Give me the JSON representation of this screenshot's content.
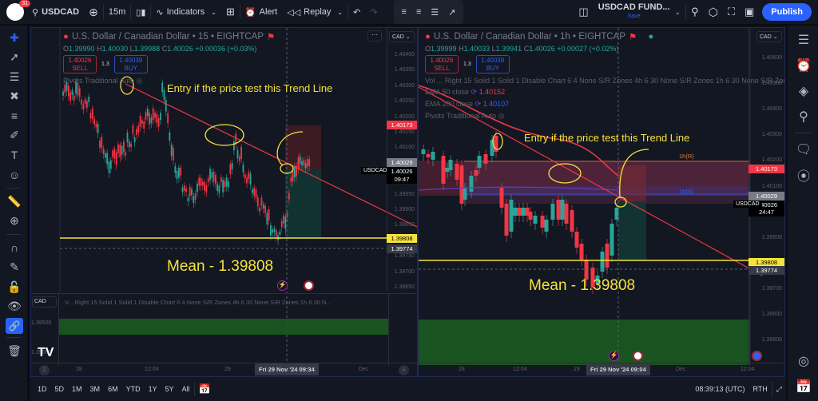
{
  "topbar": {
    "notifications": "31",
    "symbol": "USDCAD",
    "interval": "15m",
    "indicators": "Indicators",
    "alert": "Alert",
    "replay": "Replay",
    "layout_name": "USDCAD FUND...",
    "layout_status": "Save",
    "publish": "Publish"
  },
  "left_chart": {
    "title": "U.S. Dollar / Canadian Dollar • 15 • EIGHTCAP",
    "ohlc": {
      "o": "1.39990",
      "h": "1.40030",
      "l": "1.39988",
      "c": "1.40026",
      "chg": "+0.00036 (+0.03%)"
    },
    "sell": {
      "price": "1.40026",
      "label": "SELL"
    },
    "buy": {
      "price": "1.40039",
      "label": "BUY"
    },
    "spread": "1.3",
    "indicator": "Pivots Traditional Auto",
    "annotation": "Entry if the price test this Trend Line",
    "mean_label": "Mean - 1.39808",
    "currency": "CAD",
    "price_ticks": [
      "1.40400",
      "1.40350",
      "1.40300",
      "1.40250",
      "1.40200",
      "1.40150",
      "1.40100",
      "1.40050",
      "1.40000",
      "1.39950",
      "1.39900",
      "1.39850",
      "1.39800",
      "1.39750",
      "1.39700",
      "1.39650"
    ],
    "labels": {
      "red": "1.40173",
      "gray": "1.40029",
      "current": "1.40026",
      "countdown": "09:47",
      "symbol_tag": "USDCAD",
      "mean": "1.39808",
      "dashed": "1.39774"
    },
    "sub_indicator": "V...  Right 15 Solid 1 Solid 1 Disable Chart 6 4 None S/R Zones 4h 6 30 None S/R Zones 1h 6 30 N...",
    "sub_currency": "CAD",
    "sub_ticks": [
      "1.39500",
      "1.39000"
    ],
    "time_ticks": [
      "28",
      "12:04",
      "29",
      "Dec"
    ],
    "time_cursor": "Fri 29 Nov '24   09:34",
    "z_btn": "Z",
    "a_btn": "A"
  },
  "right_chart": {
    "title": "U.S. Dollar / Canadian Dollar • 1h • EIGHTCAP",
    "ohlc": {
      "o": "1.39999",
      "h": "1.40033",
      "l": "1.39941",
      "c": "1.40026",
      "chg": "+0.00027 (+0.02%)"
    },
    "sell": {
      "price": "1.40026",
      "label": "SELL"
    },
    "buy": {
      "price": "1.40039",
      "label": "BUY"
    },
    "spread": "1.3",
    "indicator1": "Vol ... Right 15 Solid 1 Solid 1 Disable Chart 6 4 None S/R Zones 4h 6 30 None S/R Zones 1h 6 30 None S/R Zon...",
    "ema50": {
      "label": "EMA 50 close",
      "value": "1.40152"
    },
    "ema200": {
      "label": "EMA 200 close",
      "value": "1.40107"
    },
    "indicator2": "Pivots Traditional Auto",
    "annotation": "Entry if the price test this Trend Line",
    "mean_label": "Mean - 1.39808",
    "zone_r": "1h(R)",
    "zone_s": "1h(S)",
    "currency": "CAD",
    "price_ticks": [
      "1.40600",
      "1.40500",
      "1.40400",
      "1.40300",
      "1.40200",
      "1.40100",
      "1.40000",
      "1.39900",
      "1.39800",
      "1.39700",
      "1.39600",
      "1.39500"
    ],
    "labels": {
      "red": "1.40173",
      "gray": "1.40029",
      "current": "1.40026",
      "countdown": "24:47",
      "symbol_tag": "USDCAD",
      "mean": "1.39808",
      "dashed": "1.39774"
    },
    "time_ticks": [
      "28",
      "12:04",
      "29",
      "Dec",
      "12:04"
    ],
    "time_cursor": "Fri 29 Nov '24   09:04"
  },
  "bottombar": {
    "ranges": [
      "1D",
      "5D",
      "1M",
      "3M",
      "6M",
      "YTD",
      "1Y",
      "5Y",
      "All"
    ],
    "clock": "08:39:13 (UTC)",
    "session": "RTH"
  },
  "colors": {
    "accent": "#2962ff",
    "up": "#26a69a",
    "down": "#f23645",
    "annotation": "#f5e33b",
    "mean_line": "#f5e33b"
  }
}
